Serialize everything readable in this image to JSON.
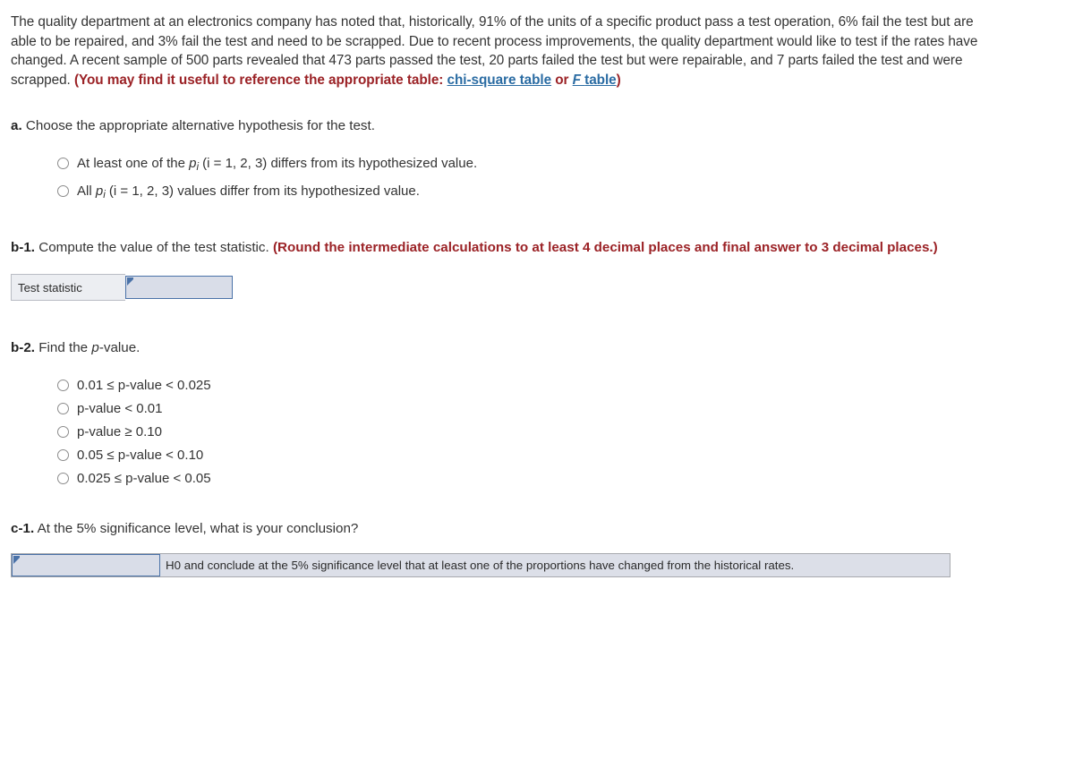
{
  "stem": {
    "part1": "The quality department at an electronics company has noted that, historically, 91% of the units of a specific product pass a test operation, 6% fail the test but are able to be repaired, and 3% fail the test and need to be scrapped. Due to recent process improvements, the quality department would like to test if the rates have changed. A recent sample of 500 parts revealed that 473 parts passed the test, 20 parts failed the test but were repairable, and 7 parts failed the test and were scrapped.",
    "hint_open": "(You may find it useful to reference the appropriate table:",
    "link_chi": "chi-square table",
    "hint_or": "or",
    "link_f_italic": "F",
    "link_f_rest": "table",
    "hint_close": ")"
  },
  "part_a": {
    "label": "a.",
    "prompt": "Choose the appropriate alternative hypothesis for the test.",
    "options": [
      {
        "pre": "At least one of the ",
        "p": "p",
        "sub": "i",
        "post": " (i = 1, 2, 3) differs from its hypothesized value."
      },
      {
        "pre": "All ",
        "p": "p",
        "sub": "i",
        "post": " (i = 1, 2, 3) values differ from its hypothesized value."
      }
    ]
  },
  "part_b1": {
    "label": "b-1.",
    "prompt": "Compute the value of the test statistic.",
    "instruction": "(Round the intermediate calculations to at least 4 decimal places and final answer to 3 decimal places.)",
    "row_label": "Test statistic",
    "input_value": "",
    "input_placeholder": ""
  },
  "part_b2": {
    "label": "b-2.",
    "prompt_pre": "Find the ",
    "prompt_p": "p",
    "prompt_post": "-value.",
    "options": [
      "0.01 ≤ p-value < 0.025",
      "p-value < 0.01",
      "p-value ≥ 0.10",
      "0.05 ≤ p-value < 0.10",
      "0.025 ≤ p-value < 0.05"
    ]
  },
  "part_c1": {
    "label": "c-1.",
    "prompt": "At the 5% significance level, what is your conclusion?",
    "select_value": "",
    "conclusion_text": "H0 and conclude at the 5% significance level that at least one of the proportions have changed from the historical rates."
  },
  "colors": {
    "red_bold": "#9b2226",
    "link_blue": "#2b6ca3",
    "field_fill": "#d9dde8",
    "field_border": "#4a72a8",
    "label_cell_bg": "#eceef2",
    "text": "#333333"
  },
  "icons": {
    "radio": "radio-button-icon",
    "flag": "cell-comment-flag-icon"
  }
}
